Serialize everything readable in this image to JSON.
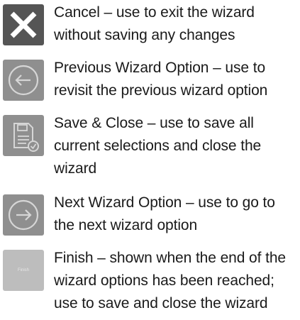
{
  "items": [
    {
      "icon": "close-icon",
      "text": "Cancel – use to exit the wizard without saving any changes"
    },
    {
      "icon": "arrow-left-circle-icon",
      "text": "Previous Wizard Option – use to revisit the previous wizard option"
    },
    {
      "icon": "save-close-icon",
      "text": "Save & Close – use to save all current selections and close the wizard"
    },
    {
      "icon": "arrow-right-circle-icon",
      "text": "Next Wizard Option – use to go to the next wizard option"
    },
    {
      "icon": "finish-button-icon",
      "icon_label": "Finish",
      "text": "Finish – shown when the end of the wizard options has been reached; use to save and close the wizard"
    }
  ],
  "colors": {
    "cancel_bg": "#555555",
    "icon_bg": "#8f8f8f",
    "icon_fg": "#d6d6d6",
    "finish_bg": "#bdbdbd"
  }
}
